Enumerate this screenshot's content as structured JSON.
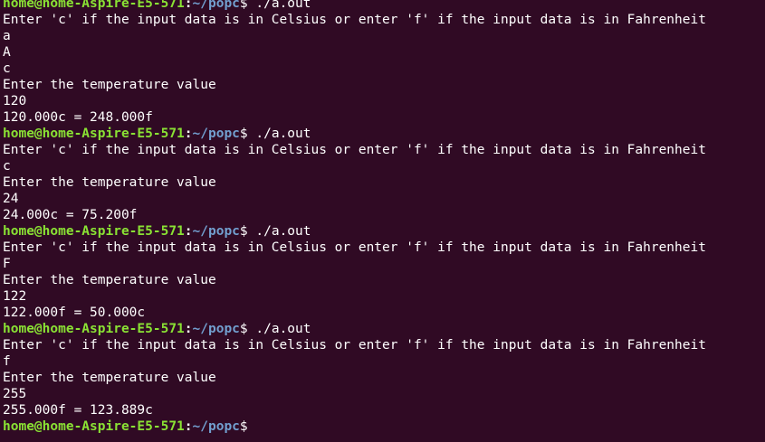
{
  "terminal": {
    "prompt_user_host": "home@home-Aspire-E5-571",
    "prompt_colon": ":",
    "prompt_path": "~/popc",
    "prompt_symbol": "$",
    "lines": [
      {
        "type": "prompt",
        "command": " ./a.out"
      },
      {
        "type": "output",
        "text": "Enter 'c' if the input data is in Celsius or enter 'f' if the input data is in Fahrenheit"
      },
      {
        "type": "output",
        "text": "a"
      },
      {
        "type": "output",
        "text": "A"
      },
      {
        "type": "output",
        "text": "c"
      },
      {
        "type": "output",
        "text": "Enter the temperature value"
      },
      {
        "type": "output",
        "text": "120"
      },
      {
        "type": "output",
        "text": "120.000c = 248.000f"
      },
      {
        "type": "prompt",
        "command": " ./a.out"
      },
      {
        "type": "output",
        "text": "Enter 'c' if the input data is in Celsius or enter 'f' if the input data is in Fahrenheit"
      },
      {
        "type": "output",
        "text": "c"
      },
      {
        "type": "output",
        "text": "Enter the temperature value"
      },
      {
        "type": "output",
        "text": "24"
      },
      {
        "type": "output",
        "text": "24.000c = 75.200f"
      },
      {
        "type": "prompt",
        "command": " ./a.out"
      },
      {
        "type": "output",
        "text": "Enter 'c' if the input data is in Celsius or enter 'f' if the input data is in Fahrenheit"
      },
      {
        "type": "output",
        "text": "F"
      },
      {
        "type": "output",
        "text": "Enter the temperature value"
      },
      {
        "type": "output",
        "text": "122"
      },
      {
        "type": "output",
        "text": "122.000f = 50.000c"
      },
      {
        "type": "prompt",
        "command": " ./a.out"
      },
      {
        "type": "output",
        "text": "Enter 'c' if the input data is in Celsius or enter 'f' if the input data is in Fahrenheit"
      },
      {
        "type": "output",
        "text": "f"
      },
      {
        "type": "output",
        "text": "Enter the temperature value"
      },
      {
        "type": "output",
        "text": "255"
      },
      {
        "type": "output",
        "text": "255.000f = 123.889c"
      },
      {
        "type": "prompt",
        "command": ""
      }
    ]
  },
  "colors": {
    "background": "#300a24",
    "user_host": "#8ae234",
    "path": "#729fcf",
    "text": "#ffffff"
  }
}
